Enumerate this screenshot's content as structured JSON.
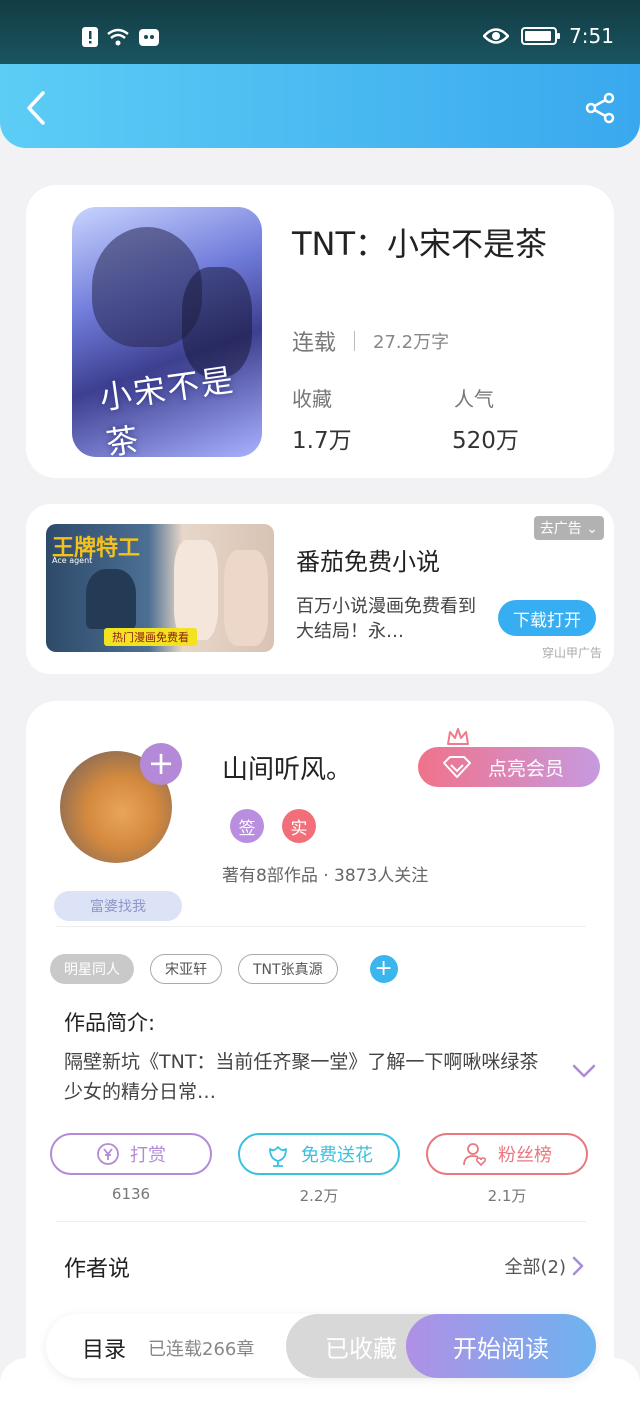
{
  "status_bar": {
    "time": "7:51"
  },
  "book": {
    "title": "TNT：小宋不是茶",
    "cover_text": "小宋不是茶",
    "status": "连载",
    "word_count": "27.2万字",
    "stats": [
      {
        "label": "收藏",
        "value": "1.7万"
      },
      {
        "label": "人气",
        "value": "520万"
      }
    ]
  },
  "ad": {
    "image_title": "王牌特工",
    "image_subtitle": "Ace agent",
    "image_banner": "热门漫画免费看",
    "badge": "去广告",
    "title": "番茄免费小说",
    "description": "百万小说漫画免费看到大结局！永…",
    "button": "下载打开",
    "source": "穿山甲广告"
  },
  "author": {
    "name": "山间听风。",
    "badges": [
      {
        "label": "签",
        "color": "#b98ee0"
      },
      {
        "label": "实",
        "color": "#f26f7a"
      }
    ],
    "stats": "著有8部作品 · 3873人关注",
    "fan_tag": "富婆找我",
    "vip_button": "点亮会员"
  },
  "tags": [
    "明星同人",
    "宋亚轩",
    "TNT张真源"
  ],
  "intro": {
    "label": "作品简介:",
    "text": "隔壁新坑《TNT：当前任齐聚一堂》了解一下啊啾咪绿茶少女的精分日常…"
  },
  "actions": [
    {
      "label": "打赏",
      "count": "6136",
      "color": "#b48ad8"
    },
    {
      "label": "免费送花",
      "count": "2.2万",
      "color": "#3ac1e0"
    },
    {
      "label": "粉丝榜",
      "count": "2.1万",
      "color": "#e9777f"
    }
  ],
  "author_say": {
    "label": "作者说",
    "all": "全部(2)"
  },
  "bottom_bar": {
    "toc": "目录",
    "chapters": "已连载266章",
    "collected": "已收藏",
    "read": "开始阅读"
  }
}
